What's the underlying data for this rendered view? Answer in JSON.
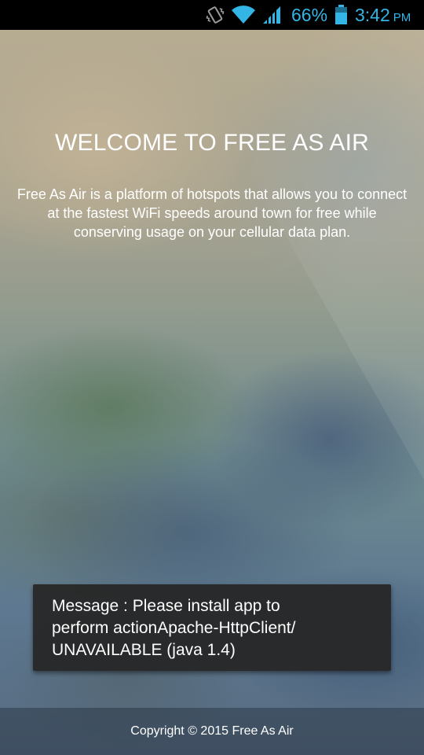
{
  "status_bar": {
    "battery_percent": "66%",
    "time": "3:42",
    "ampm": "PM",
    "icons": [
      "vibrate-icon",
      "wifi-icon",
      "cell-signal-icon",
      "battery-icon"
    ],
    "accent_color": "#33b5e5"
  },
  "welcome": {
    "title": "WELCOME TO FREE AS AIR",
    "description": "Free As Air is a platform of hotspots that allows you to connect at the fastest WiFi speeds around town for free while conserving usage on your cellular data plan."
  },
  "toast": {
    "message": "Message : Please install app to\nperform actionApache-HttpClient/\nUNAVAILABLE (java 1.4)"
  },
  "footer": {
    "copyright": "Copyright © 2015 Free As Air"
  }
}
